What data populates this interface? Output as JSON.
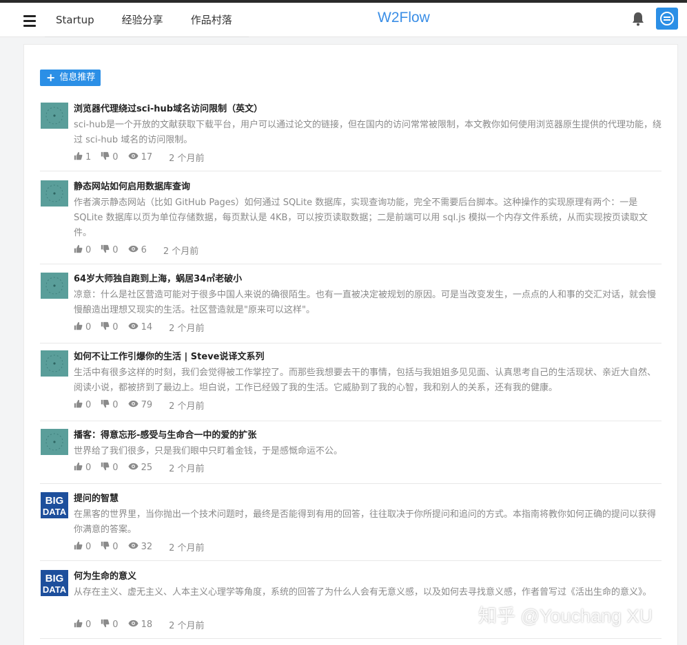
{
  "header": {
    "nav": [
      "Startup",
      "经验分享",
      "作品村落"
    ],
    "brand": "W2Flow"
  },
  "main": {
    "recommend_label": "信息推荐",
    "items": [
      {
        "title": "浏览器代理绕过sci-hub域名访问限制（英文）",
        "desc": "sci-hub是一个开放的文献获取下载平台，用户可以通过论文的链接，但在国内的访问常常被限制，本文教你如何使用浏览器原生提供的代理功能，绕过 sci-hub 域名的访问限制。",
        "likes": "1",
        "dislikes": "0",
        "views": "17",
        "time": "2 个月前",
        "thumb": "clock"
      },
      {
        "title": "静态网站如何启用数据库查询",
        "desc": "作者演示静态网站（比如 GitHub Pages）如何通过 SQLite 数据库，实现查询功能，完全不需要后台脚本。这种操作的实现原理有两个：一是 SQLite 数据库以页为单位存储数据，每页默认是 4KB，可以按页读取数据；二是前端可以用 sql.js 模拟一个内存文件系统，从而实现按页读取文件。",
        "likes": "0",
        "dislikes": "0",
        "views": "6",
        "time": "2 个月前",
        "thumb": "clock"
      },
      {
        "title": "64岁大师独自跑到上海，蜗居34㎡老破小",
        "desc": "凉意：什么是社区营造可能对于很多中国人来说的确很陌生。也有一直被决定被规划的原因。可是当改变发生，一点点的人和事的交汇对话，就会慢慢酿造出理想又现实的生活。社区营造就是\"原来可以这样\"。",
        "likes": "0",
        "dislikes": "0",
        "views": "14",
        "time": "2 个月前",
        "thumb": "clock"
      },
      {
        "title": "如何不让工作引爆你的生活 | Steve说译文系列",
        "desc": "生活中有很多这样的时刻，我们会觉得被工作掌控了。而那些我想要去干的事情，包括与我姐姐多见见面、认真思考自己的生活现状、亲近大自然、阅读小说，都被挤到了最边上。坦白说，工作已经毁了我的生活。它威胁到了我的心智，我和别人的关系，还有我的健康。",
        "likes": "0",
        "dislikes": "0",
        "views": "79",
        "time": "2 个月前",
        "thumb": "clock"
      },
      {
        "title": "播客：得意忘形-感受与生命合一中的爱的扩张",
        "desc": "世界给了我们很多，只是我们眼中只盯着金钱，于是感慨命运不公。",
        "likes": "0",
        "dislikes": "0",
        "views": "25",
        "time": "2 个月前",
        "thumb": "clock"
      },
      {
        "title": "提问的智慧",
        "desc": "在黑客的世界里，当你抛出一个技术问题时，最终是否能得到有用的回答，往往取决于你所提问和追问的方式。本指南将教你如何正确的提问以获得你满意的答案。",
        "likes": "0",
        "dislikes": "0",
        "views": "32",
        "time": "2 个月前",
        "thumb": "bigdata",
        "thumb_text": [
          "BIG",
          "DATA"
        ]
      },
      {
        "title": "何为生命的意义",
        "desc": "从存在主义、虚无主义、人本主义心理学等角度，系统的回答了为什么人会有无意义感，以及如何去寻找意义感，作者曾写过《活出生命的意义》。",
        "likes": "0",
        "dislikes": "0",
        "views": "18",
        "time": "2 个月前",
        "thumb": "bigdata",
        "thumb_text": [
          "BIG",
          "DATA"
        ]
      }
    ]
  },
  "watermark": "知乎 @Youchang XU",
  "colors": {
    "accent": "#2b8fe6",
    "brand": "#3a8ee6",
    "thumb_teal": "#5a9e9a"
  }
}
